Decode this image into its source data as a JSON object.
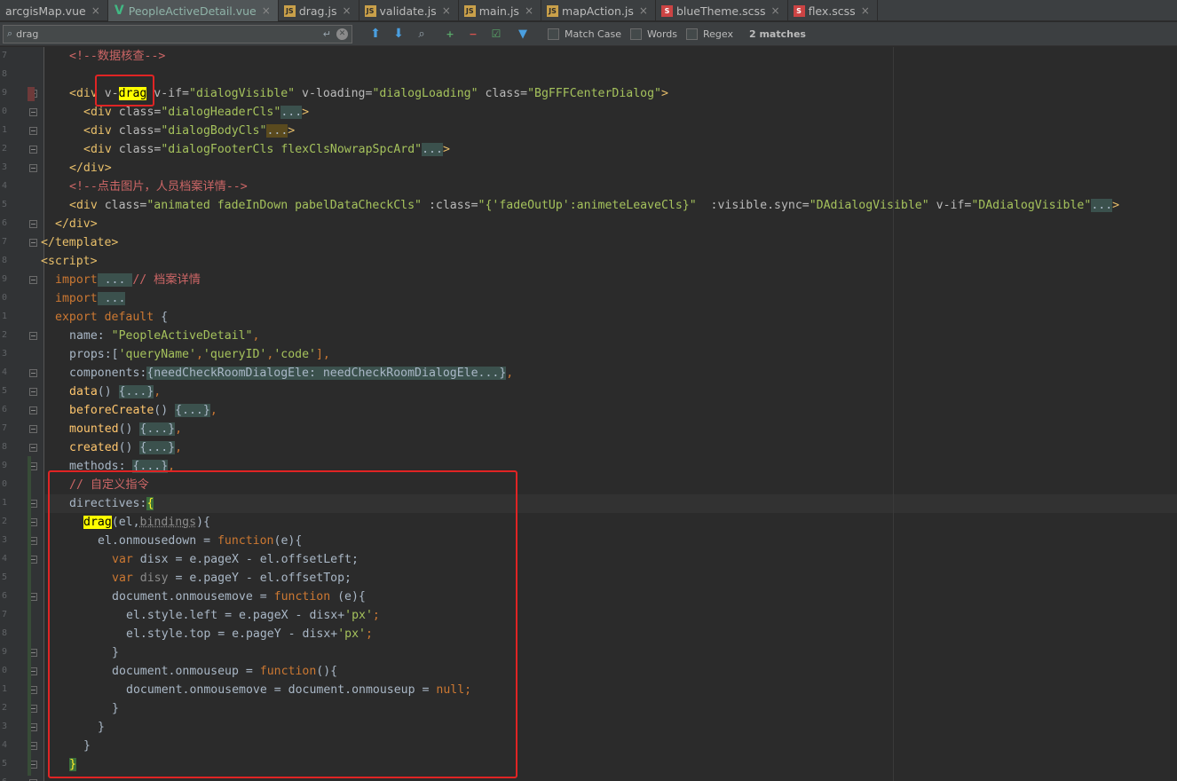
{
  "tabs": [
    {
      "label": "arcgisMap.vue",
      "icon": "none",
      "active": false
    },
    {
      "label": "PeopleActiveDetail.vue",
      "icon": "vue",
      "active": true
    },
    {
      "label": "drag.js",
      "icon": "js",
      "active": false
    },
    {
      "label": "validate.js",
      "icon": "js",
      "active": false
    },
    {
      "label": "main.js",
      "icon": "js",
      "active": false
    },
    {
      "label": "mapAction.js",
      "icon": "js",
      "active": false
    },
    {
      "label": "blueTheme.scss",
      "icon": "scss",
      "active": false
    },
    {
      "label": "flex.scss",
      "icon": "scss",
      "active": false
    }
  ],
  "search": {
    "query": "drag",
    "match_case_label": "Match Case",
    "words_label": "Words",
    "regex_label": "Regex",
    "matches_label": "2 matches"
  },
  "code": {
    "l1": "<!--数据核查-->",
    "l3_div": "<div ",
    "l3_vdrag_pre": "v-",
    "l3_vdrag_hl": "drag",
    "l3_rest_a": " v-if=",
    "l3_rest_b": "\"dialogVisible\"",
    "l3_rest_c": " v-loading=",
    "l3_rest_d": "\"dialogLoading\"",
    "l3_rest_e": " class=",
    "l3_rest_f": "\"BgFFFCenterDialog\"",
    "l3_rest_g": ">",
    "l4a": "<div ",
    "l4b": "class=",
    "l4c": "\"dialogHeaderCls\"",
    "l4d": "...",
    "l4e": ">",
    "l5c": "\"dialogBodyCls\"",
    "l6c": "\"dialogFooterCls flexClsNowrapSpcArd\"",
    "l7": "</div>",
    "l8": "<!--点击图片，人员档案详情-->",
    "l9a": "<div ",
    "l9b": "class=",
    "l9c": "\"animated fadeInDown pabelDataCheckCls\"",
    "l9d": " :class=",
    "l9e": "\"{'fadeOutUp':animeteLeaveCls}\"",
    "l9f": "  :visible.sync=",
    "l9g": "\"DAdialogVisible\"",
    "l9h": " v-if=",
    "l9i": "\"DAdialogVisible\"",
    "l9j": "...",
    "l9k": ">",
    "l10": "</div>",
    "l11": "</template>",
    "l12": "<script>",
    "l13a": "import",
    "l13b": " ... ",
    "l13c": "// 档案详情",
    "l14a": "import",
    "l14b": " ...",
    "l15a": "export default",
    "l15b": " {",
    "l16a": "name",
    "l16b": ": ",
    "l16c": "\"PeopleActiveDetail\"",
    "l16d": ",",
    "l17a": "props",
    "l17b": ":[",
    "l17c": "'queryName'",
    "l17d": ",",
    "l17e": "'queryID'",
    "l17f": ",",
    "l17g": "'code'",
    "l17h": "],",
    "l18a": "components",
    "l18b": ":",
    "l18c": "{needCheckRoomDialogEle: needCheckRoomDialogEle...}",
    "l18d": ",",
    "l19a": "data",
    "l19b": "() ",
    "l19c": "{...}",
    "l19d": ",",
    "l20a": "beforeCreate",
    "l21a": "mounted",
    "l22a": "created",
    "l23a": "methods",
    "l23b": ": ",
    "l24": "// 自定义指令",
    "l25a": "directives",
    "l25b": ":",
    "l25c": "{",
    "l26a": "drag",
    "l26b": "(el,",
    "l26c": "bindings",
    "l26d": "){",
    "l27a": "el",
    "l27b": ".onmousedown = ",
    "l27c": "function",
    "l27d": "(e){",
    "l28a": "var ",
    "l28b": "disx",
    "l28c": " = e.pageX - ",
    "l28d": "el",
    "l28e": ".offsetLeft;",
    "l29b": "disy",
    "l29c": " = e.pageY - ",
    "l29e": ".offsetTop;",
    "l30a": "document",
    "l30b": ".onmousemove = ",
    "l30c": "function ",
    "l30d": "(e){",
    "l31a": "el",
    "l31b": ".style.left = e.pageX - disx+",
    "l31c": "'px'",
    "l31d": ";",
    "l32b": ".style.top = e.pageY - disx+",
    "l33": "}",
    "l34a": "document",
    "l34b": ".onmouseup = ",
    "l34c": "function",
    "l34d": "(){",
    "l35a": "document",
    "l35b": ".onmousemove = ",
    "l35c": "document",
    "l35d": ".onmouseup = ",
    "l35e": "null",
    "l35f": ";",
    "l36": "}",
    "l37": "}",
    "l38": "}",
    "l39": "}"
  },
  "gutter_numbers": [
    "7",
    "8",
    "9",
    "0",
    "1",
    "2",
    "3",
    "4",
    "5",
    "6",
    "7",
    "8",
    "9",
    "0",
    "1",
    "2",
    "3",
    "4",
    "5",
    "6",
    "7",
    "8",
    "9",
    "0",
    "1",
    "2",
    "3",
    "4",
    "5",
    "6",
    "7",
    "8",
    "9",
    "0",
    "1",
    "2",
    "3",
    "4",
    "5",
    "6"
  ],
  "colors": {
    "keyword": "#cc7832",
    "tag": "#e8bf6a",
    "string": "#a5c25c",
    "comment": "#cc6666",
    "annotation_box": "#e02424"
  }
}
